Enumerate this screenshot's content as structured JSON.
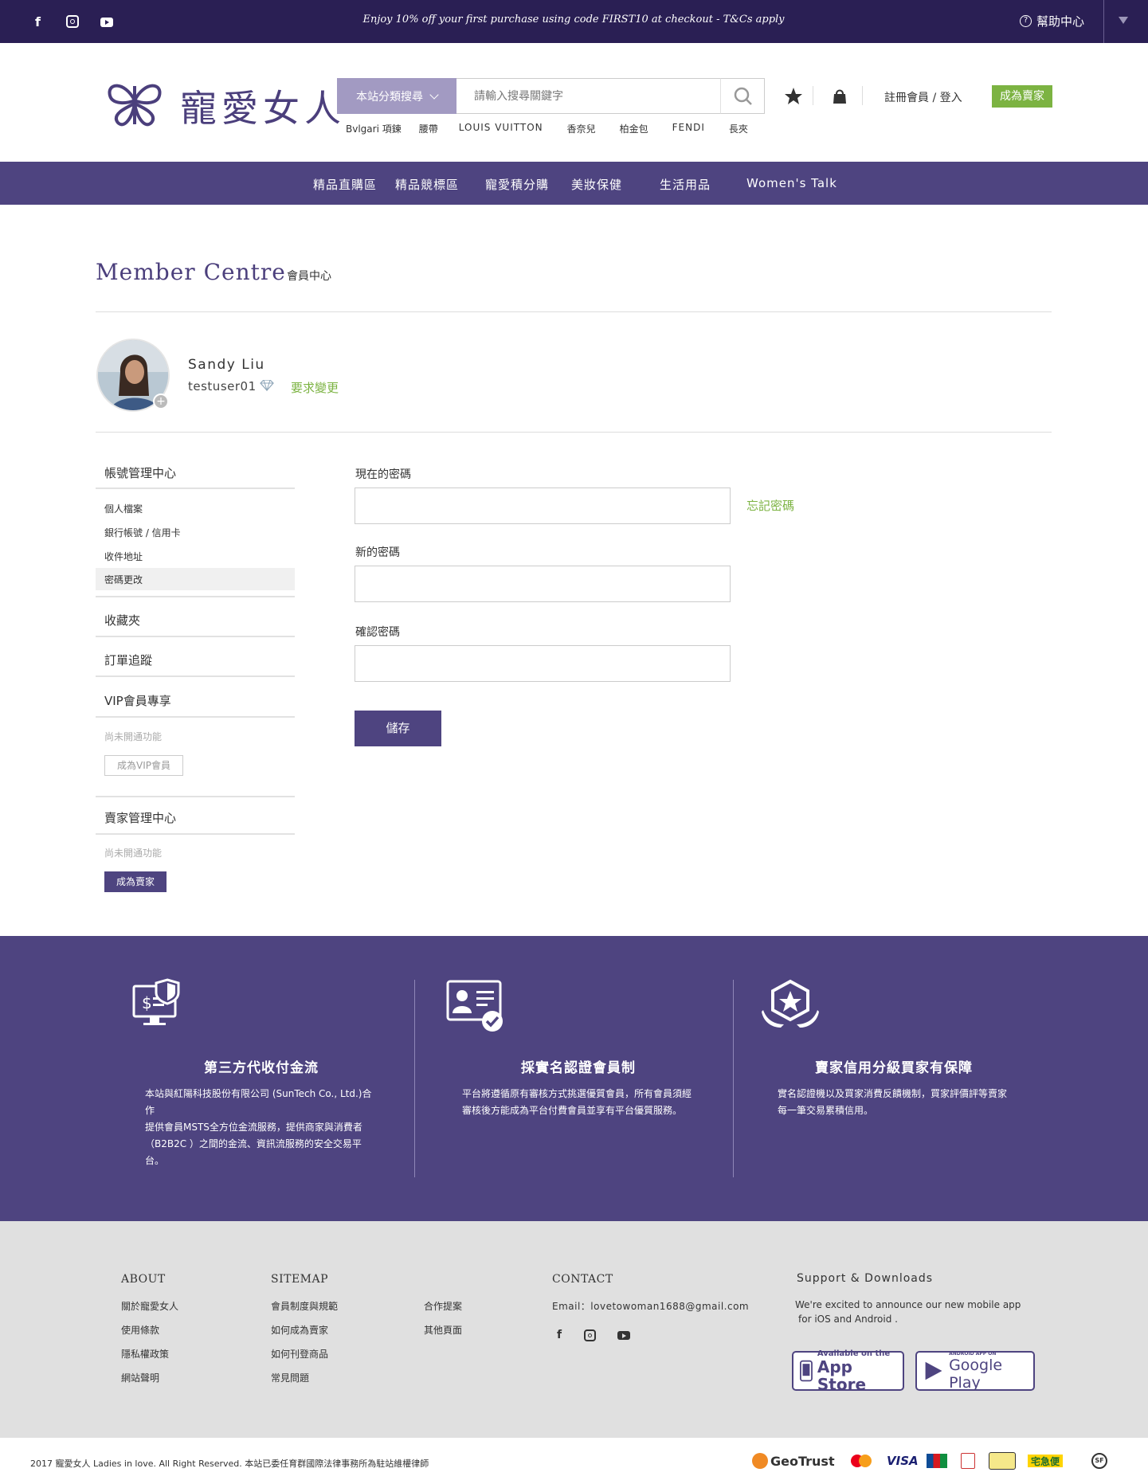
{
  "topbar": {
    "promo": "Enjoy 10% off your first purchase using code FIRST10 at checkout - T&Cs apply",
    "help_label": "幫助中心",
    "social_icons": [
      "facebook-icon",
      "instagram-icon",
      "youtube-icon"
    ]
  },
  "header": {
    "logo_text": "寵愛女人",
    "category_search_label": "本站分類搜尋",
    "search_placeholder": "請輸入搜尋關鍵字",
    "hot_tags": [
      "Bvlgari 項鍊",
      "腰帶",
      "LOUIS VUITTON",
      "香奈兒",
      "柏金包",
      "FENDI",
      "長夾"
    ],
    "login_label": "註冊會員 / 登入",
    "become_seller_label": "成為賣家"
  },
  "nav": {
    "items": [
      "精品直購區",
      "精品競標區",
      "寵愛積分購",
      "美妝保健",
      "生活用品",
      "Women's Talk"
    ]
  },
  "page": {
    "title": "Member Centre",
    "subtitle": "會員中心"
  },
  "profile": {
    "name": "Sandy Liu",
    "user_id": "testuser01",
    "change_request": "要求變更"
  },
  "sidebar": {
    "account_center": "帳號管理中心",
    "account_items": [
      "個人檔案",
      "銀行帳號 / 信用卡",
      "收件地址",
      "密碼更改"
    ],
    "favorites": "收藏夾",
    "orders": "訂單追蹤",
    "vip_title": "VIP會員專享",
    "vip_note": "尚未開通功能",
    "vip_button": "成為VIP會員",
    "seller_center": "賣家管理中心",
    "seller_note": "尚未開通功能",
    "seller_button": "成為賣家"
  },
  "form": {
    "current_password_label": "現在的密碼",
    "forgot_password": "忘記密碼",
    "new_password_label": "新的密碼",
    "confirm_password_label": "確認密碼",
    "save_button": "儲存"
  },
  "features": [
    {
      "icon": "secure-payment-icon",
      "title": "第三方代收付金流",
      "text": "本站與紅陽科技股份有限公司 (SunTech Co., Ltd.)合作\n提供會員MSTS全方位金流服務，提供商家與消費者（B2B2C ）之間的金流、資訊流服務的安全交易平台。"
    },
    {
      "icon": "verified-id-icon",
      "title": "採實名認證會員制",
      "text": "平台將遵循原有審核方式挑選優質會員，所有會員須經審核後方能成為平台付費會員並享有平台優質服務。"
    },
    {
      "icon": "star-shield-icon",
      "title": "賣家信用分級買家有保障",
      "text": "實名認證機以及買家消費反饋機制，買家評價評等賣家每一筆交易累積信用。"
    }
  ],
  "footer": {
    "about_title": "ABOUT",
    "about_links": [
      "關於寵愛女人",
      "使用條款",
      "隱私權政策",
      "網站聲明"
    ],
    "sitemap_title": "SITEMAP",
    "sitemap_links_1": [
      "會員制度與規範",
      "如何成為賣家",
      "如何刊登商品",
      "常見問題"
    ],
    "sitemap_links_2": [
      "合作提案",
      "其他頁面"
    ],
    "contact_title": "CONTACT",
    "contact_email": "Email：lovetowoman1688@gmail.com",
    "support_title": "Support & Downloads",
    "support_text_1": "We're excited to announce our new mobile app",
    "support_text_2": "for iOS and Android .",
    "appstore_small": "Available on the",
    "appstore_big": "App Store",
    "googleplay_small": "ANDROID APP ON",
    "googleplay_big": "Google Play"
  },
  "bottom": {
    "copyright": "2017 寵愛女人 Ladies in love. All Right Reserved.   本站已委任育群國際法律事務所為駐站維權律師",
    "payments": [
      "GeoTrust",
      "MasterCard",
      "VISA",
      "JCB",
      "UnionPay",
      "ATM",
      "宅急便",
      "SF"
    ]
  },
  "colors": {
    "topbar": "#2a1f54",
    "brand_purple": "#4e4480",
    "accent_green": "#7cb342",
    "footer_gray": "#e0e0e0"
  }
}
